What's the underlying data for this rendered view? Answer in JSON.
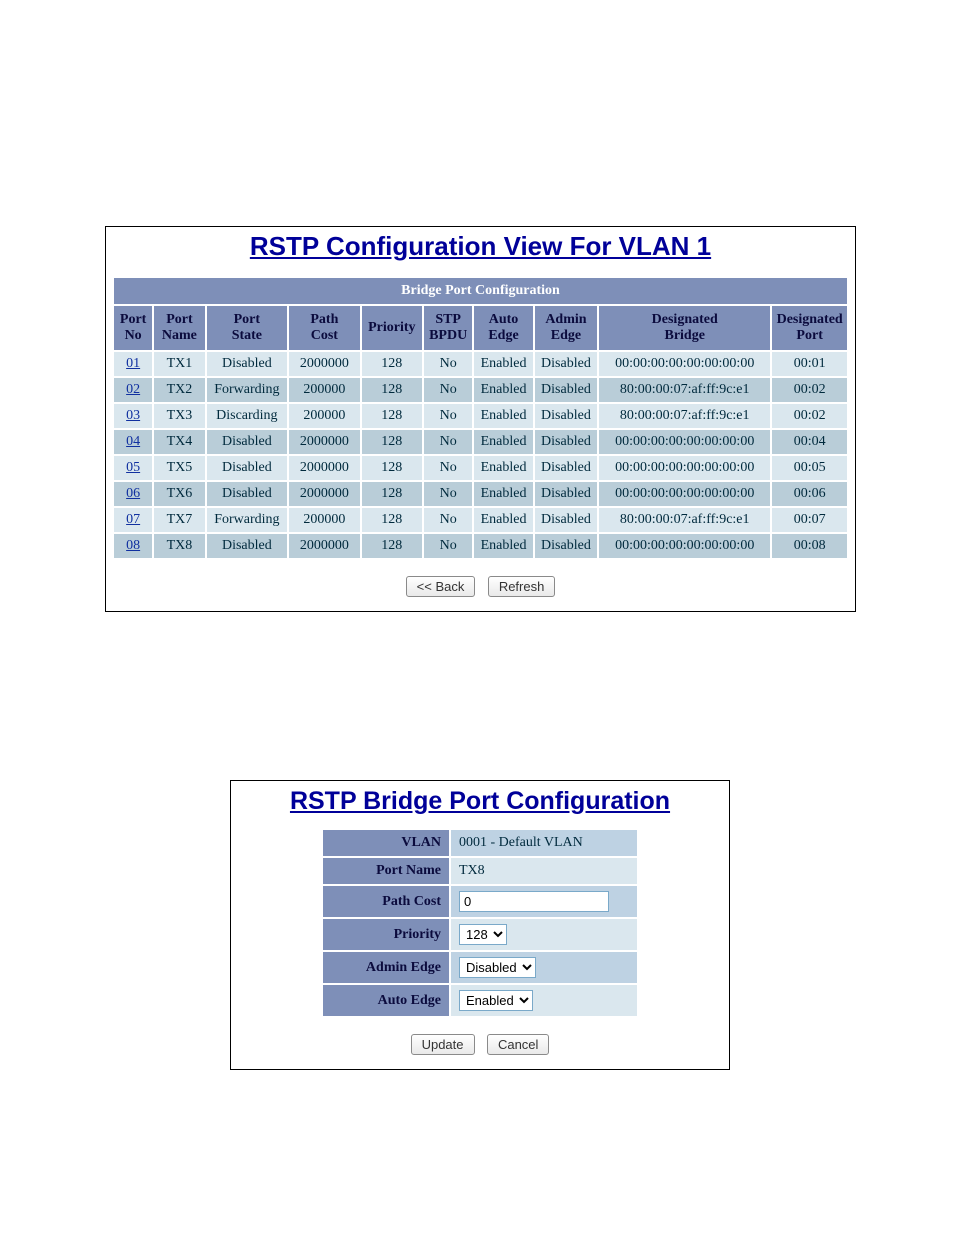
{
  "panel1": {
    "title": "RSTP Configuration View For VLAN 1",
    "caption": "Bridge Port Configuration",
    "headers": [
      "Port\nNo",
      "Port\nName",
      "Port\nState",
      "Path\nCost",
      "Priority",
      "STP\nBPDU",
      "Auto\nEdge",
      "Admin\nEdge",
      "Designated\nBridge",
      "Designated\nPort"
    ],
    "col_widths": [
      "38",
      "50",
      "80",
      "70",
      "60",
      "48",
      "58",
      "62",
      "170",
      "70"
    ],
    "rows": [
      {
        "port_no": "01",
        "name": "TX1",
        "state": "Disabled",
        "cost": "2000000",
        "prio": "128",
        "bpdu": "No",
        "auto": "Enabled",
        "admin": "Disabled",
        "db": "00:00:00:00:00:00:00:00",
        "dp": "00:01"
      },
      {
        "port_no": "02",
        "name": "TX2",
        "state": "Forwarding",
        "cost": "200000",
        "prio": "128",
        "bpdu": "No",
        "auto": "Enabled",
        "admin": "Disabled",
        "db": "80:00:00:07:af:ff:9c:e1",
        "dp": "00:02"
      },
      {
        "port_no": "03",
        "name": "TX3",
        "state": "Discarding",
        "cost": "200000",
        "prio": "128",
        "bpdu": "No",
        "auto": "Enabled",
        "admin": "Disabled",
        "db": "80:00:00:07:af:ff:9c:e1",
        "dp": "00:02"
      },
      {
        "port_no": "04",
        "name": "TX4",
        "state": "Disabled",
        "cost": "2000000",
        "prio": "128",
        "bpdu": "No",
        "auto": "Enabled",
        "admin": "Disabled",
        "db": "00:00:00:00:00:00:00:00",
        "dp": "00:04"
      },
      {
        "port_no": "05",
        "name": "TX5",
        "state": "Disabled",
        "cost": "2000000",
        "prio": "128",
        "bpdu": "No",
        "auto": "Enabled",
        "admin": "Disabled",
        "db": "00:00:00:00:00:00:00:00",
        "dp": "00:05"
      },
      {
        "port_no": "06",
        "name": "TX6",
        "state": "Disabled",
        "cost": "2000000",
        "prio": "128",
        "bpdu": "No",
        "auto": "Enabled",
        "admin": "Disabled",
        "db": "00:00:00:00:00:00:00:00",
        "dp": "00:06"
      },
      {
        "port_no": "07",
        "name": "TX7",
        "state": "Forwarding",
        "cost": "200000",
        "prio": "128",
        "bpdu": "No",
        "auto": "Enabled",
        "admin": "Disabled",
        "db": "80:00:00:07:af:ff:9c:e1",
        "dp": "00:07"
      },
      {
        "port_no": "08",
        "name": "TX8",
        "state": "Disabled",
        "cost": "2000000",
        "prio": "128",
        "bpdu": "No",
        "auto": "Enabled",
        "admin": "Disabled",
        "db": "00:00:00:00:00:00:00:00",
        "dp": "00:08"
      }
    ],
    "buttons": {
      "back": "<< Back",
      "refresh": "Refresh"
    }
  },
  "panel2": {
    "title": "RSTP Bridge Port Configuration",
    "fields": {
      "vlan_label": "VLAN",
      "vlan_value": "0001 - Default VLAN",
      "portname_label": "Port Name",
      "portname_value": "TX8",
      "pathcost_label": "Path Cost",
      "pathcost_value": "0",
      "priority_label": "Priority",
      "priority_value": "128",
      "adminedge_label": "Admin Edge",
      "adminedge_value": "Disabled",
      "autoedge_label": "Auto Edge",
      "autoedge_value": "Enabled"
    },
    "buttons": {
      "update": "Update",
      "cancel": "Cancel"
    }
  }
}
